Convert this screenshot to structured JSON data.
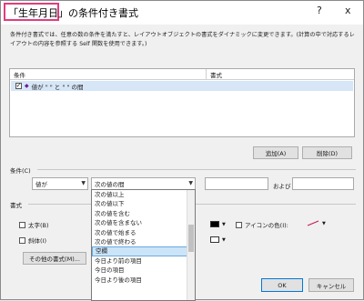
{
  "title": {
    "highlight": "「生年月日」",
    "rest": "の条件付き書式",
    "help": "?",
    "close": "x"
  },
  "description": "条件付き書式では、任意の数の条件を満たすと、レイアウトオブジェクトの書式をダイナミックに変更できます。(計算の中で対応するレイアウトの内容を参照する Self 関数を使用できます。)",
  "conditions_table": {
    "col_condition": "条件",
    "col_format": "書式",
    "rows": [
      {
        "checked": true,
        "text": "値が \" \" と \" \" の間"
      }
    ]
  },
  "buttons": {
    "add": "追加(A)",
    "delete": "削除(D)",
    "more_formats": "その他の書式(M)...",
    "ok": "OK",
    "cancel": "キャンセル"
  },
  "condition_section": {
    "label": "条件(C)",
    "type_select": "値が",
    "operator_select": "次の値の間",
    "and_label": "および"
  },
  "format_section": {
    "label": "書式",
    "bold": "太字(B)",
    "italic": "斜体(I)",
    "icon_color": "アイコンの色(I):",
    "text_color_value": "#000000",
    "icon_color_value": "#c2185b"
  },
  "operator_options": [
    "次の値以上",
    "次の値以下",
    "次の値を含む",
    "次の値を含まない",
    "次の値で始まる",
    "次の値で終わる",
    "空欄",
    "今日より前の項目",
    "今日の項目",
    "今日より後の項目"
  ],
  "operator_selected_index": 6
}
